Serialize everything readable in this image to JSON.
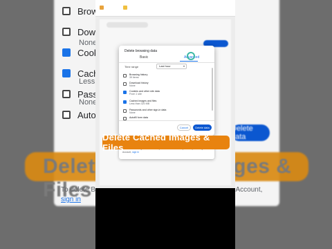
{
  "background": {
    "rows": [
      {
        "label": "Brows",
        "sub": "",
        "checked": false
      },
      {
        "label": "Down",
        "sub": "None",
        "checked": false
      },
      {
        "label": "Cooki",
        "sub": "",
        "checked": true
      },
      {
        "label": "Cache",
        "sub": "Less th",
        "checked": true
      },
      {
        "label": "Passw",
        "sub": "None",
        "checked": false
      },
      {
        "label": "Autofil",
        "sub": "",
        "checked": false
      }
    ],
    "delete_button": "Delete data",
    "banner_text": "Delete Cached Images & Files",
    "bottom_text": "To delete Brow",
    "bottom_text_right": "gle Account,",
    "bottom_link": "sign in"
  },
  "dialog": {
    "title": "Delete browsing data",
    "tab_basic": "Basic",
    "tab_advanced": "Advanced",
    "time_range_label": "Time range",
    "time_range_value": "Last hour",
    "options": [
      {
        "label": "Browsing history",
        "sub": "39 items",
        "checked": false
      },
      {
        "label": "Download history",
        "sub": "None",
        "checked": false
      },
      {
        "label": "Cookies and other site data",
        "sub": "From 1 site",
        "checked": true
      },
      {
        "label": "Cached images and files",
        "sub": "Less than 320 MB",
        "checked": true
      },
      {
        "label": "Passwords and other sign-in data",
        "sub": "None",
        "checked": false
      },
      {
        "label": "Autofill form data",
        "sub": "",
        "checked": false
      }
    ],
    "cancel_label": "Cancel",
    "delete_label": "Delete data"
  },
  "info_card": {
    "text": "To delete browsing data from all of your devices that are synced to your Google Account,",
    "link": "sign in"
  },
  "caption": "Delete Cached Images & Files",
  "colors": {
    "accent": "#0b57d0",
    "caption_bg": "#e8830f",
    "cursor_ring": "#3bb9a6"
  }
}
